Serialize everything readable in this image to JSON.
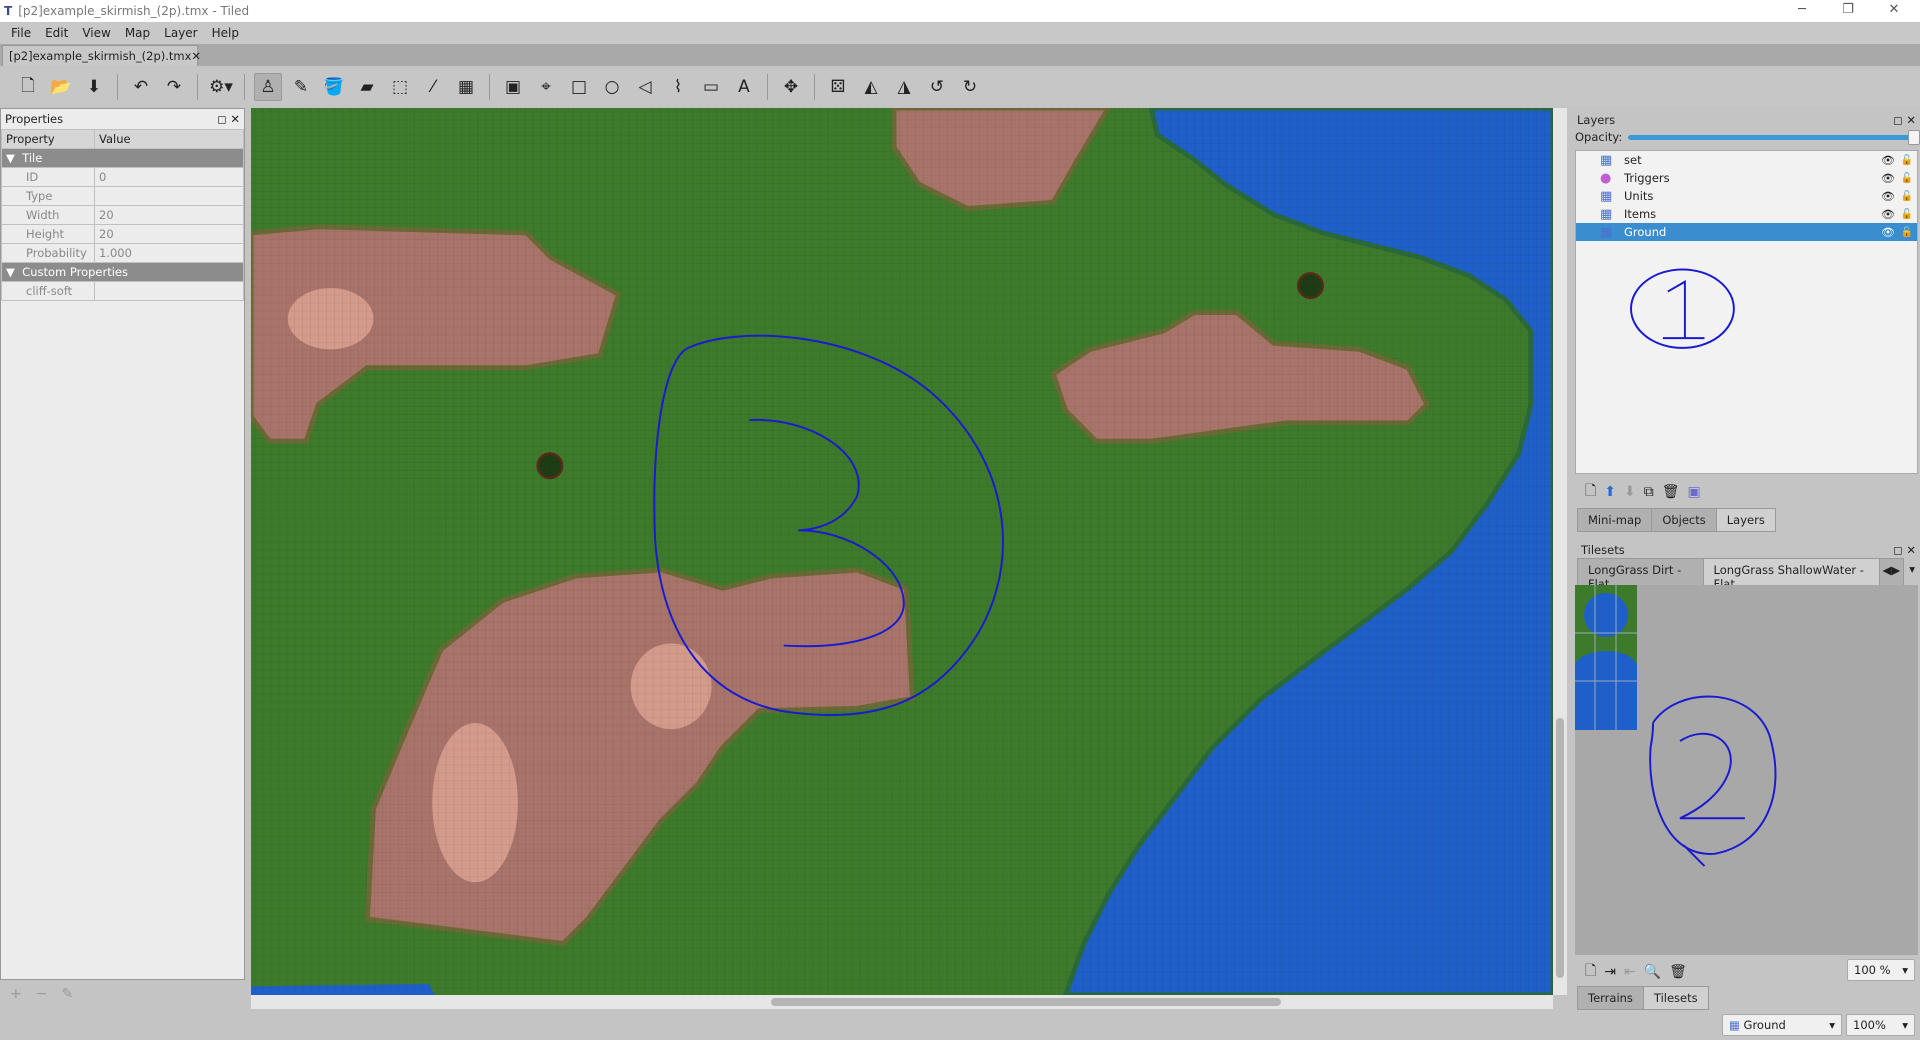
{
  "window": {
    "title": "[p2]example_skirmish_(2p).tmx - Tiled",
    "minimize": "─",
    "restore": "❐",
    "close": "✕"
  },
  "menu": [
    "File",
    "Edit",
    "View",
    "Map",
    "Layer",
    "Help"
  ],
  "document_tab": {
    "label": "[p2]example_skirmish_(2p).tmx",
    "close": "✕"
  },
  "toolbar": [
    {
      "icon": "new-map-icon",
      "g": "🗋"
    },
    {
      "icon": "open-icon",
      "g": "📂"
    },
    {
      "icon": "save-icon",
      "g": "⬇"
    },
    {
      "sep": true
    },
    {
      "icon": "undo-icon",
      "g": "↶"
    },
    {
      "icon": "redo-icon",
      "g": "↷"
    },
    {
      "sep": true
    },
    {
      "icon": "commands-icon",
      "g": "⚙▾"
    },
    {
      "sep": true
    },
    {
      "icon": "stamp-brush-icon",
      "g": "♙",
      "on": true
    },
    {
      "icon": "terrain-brush-icon",
      "g": "✎"
    },
    {
      "icon": "bucket-fill-icon",
      "g": "🪣"
    },
    {
      "icon": "eraser-icon",
      "g": "▰"
    },
    {
      "icon": "rectangle-select-icon",
      "g": "⬚"
    },
    {
      "icon": "magic-wand-icon",
      "g": "⁄"
    },
    {
      "icon": "select-same-tile-icon",
      "g": "▦"
    },
    {
      "sep": true
    },
    {
      "icon": "select-objects-icon",
      "g": "▣"
    },
    {
      "icon": "edit-polygons-icon",
      "g": "⌖"
    },
    {
      "icon": "insert-rectangle-icon",
      "g": "□"
    },
    {
      "icon": "insert-ellipse-icon",
      "g": "○"
    },
    {
      "icon": "insert-polygon-icon",
      "g": "◁"
    },
    {
      "icon": "insert-polyline-icon",
      "g": "⌇"
    },
    {
      "icon": "insert-tile-icon",
      "g": "▭"
    },
    {
      "icon": "insert-text-icon",
      "g": "A"
    },
    {
      "sep": true
    },
    {
      "icon": "move-icon",
      "g": "✥"
    },
    {
      "sep": true
    },
    {
      "icon": "random-mode-icon",
      "g": "⚄"
    },
    {
      "icon": "flip-horizontal-icon",
      "g": "◭"
    },
    {
      "icon": "flip-vertical-icon",
      "g": "◮"
    },
    {
      "icon": "rotate-left-icon",
      "g": "↺"
    },
    {
      "icon": "rotate-right-icon",
      "g": "↻"
    }
  ],
  "properties": {
    "title": "Properties",
    "col_property": "Property",
    "col_value": "Value",
    "groups": [
      {
        "name": "Tile",
        "rows": [
          {
            "k": "ID",
            "v": "0"
          },
          {
            "k": "Type",
            "v": ""
          },
          {
            "k": "Width",
            "v": "20"
          },
          {
            "k": "Height",
            "v": "20"
          },
          {
            "k": "Probability",
            "v": "1.000"
          }
        ]
      },
      {
        "name": "Custom Properties",
        "rows": [
          {
            "k": "cliff-soft",
            "v": ""
          }
        ]
      }
    ],
    "footer": [
      "+",
      "−",
      "✎"
    ]
  },
  "layers": {
    "title": "Layers",
    "opacity_label": "Opacity:",
    "opacity": 1.0,
    "items": [
      {
        "name": "set",
        "type": "tile"
      },
      {
        "name": "Triggers",
        "type": "object"
      },
      {
        "name": "Units",
        "type": "tile"
      },
      {
        "name": "Items",
        "type": "tile"
      },
      {
        "name": "Ground",
        "type": "tile",
        "selected": true
      }
    ],
    "tabs": [
      "Mini-map",
      "Objects",
      "Layers"
    ],
    "active_tab": "Layers"
  },
  "tilesets": {
    "title": "Tilesets",
    "tabs": [
      "LongGrass Dirt - Flat",
      "LongGrass ShallowWater - Flat"
    ],
    "active_tab": "LongGrass ShallowWater - Flat",
    "zoom": "100 %",
    "bottom_tabs": [
      "Terrains",
      "Tilesets"
    ],
    "active_bottom": "Tilesets"
  },
  "status": {
    "layer": "Ground",
    "zoom": "100%"
  },
  "annotations": [
    "1",
    "2",
    "3"
  ],
  "colors": {
    "grass": "#3d7a2b",
    "water": "#1f5fc9",
    "dirt": "#a8746a",
    "selection": "#3a8ed0",
    "ink": "#1a1ad0"
  }
}
